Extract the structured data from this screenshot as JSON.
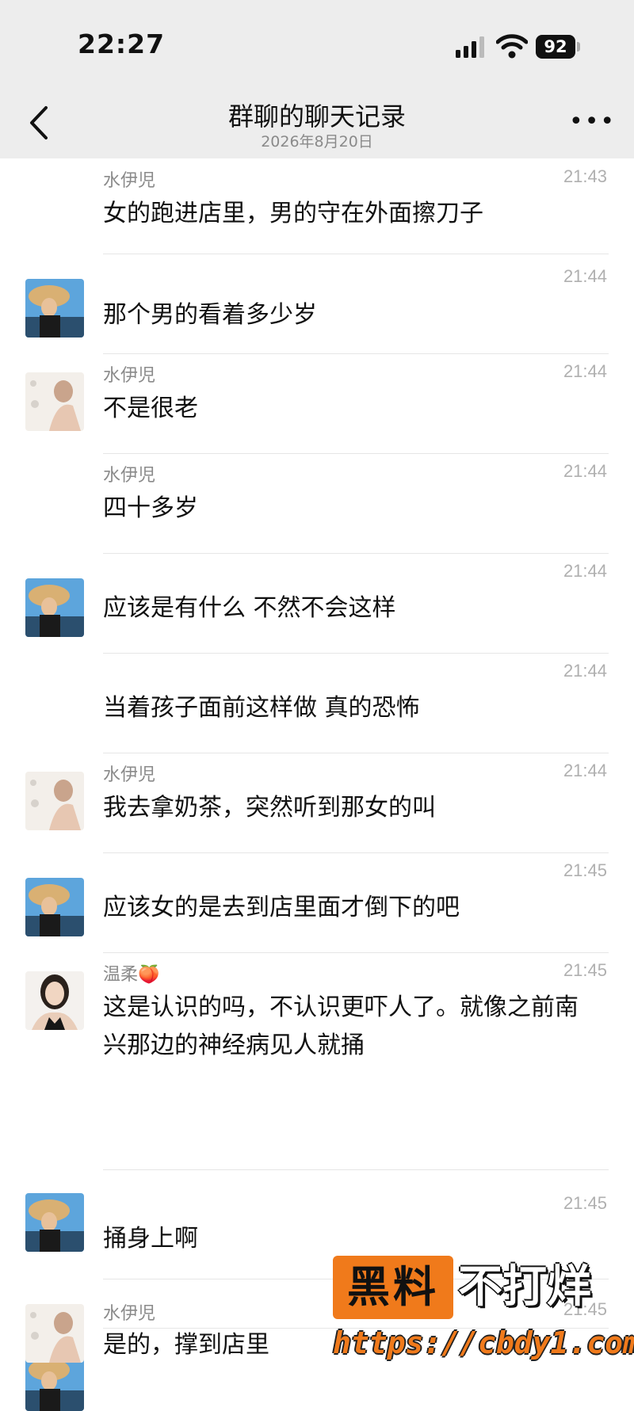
{
  "status_bar": {
    "time": "22:27",
    "battery": "92"
  },
  "nav": {
    "title": "群聊的聊天记录",
    "subtitle": "2026年8月20日",
    "more_label": "•••"
  },
  "messages": [
    {
      "sender": "水伊児",
      "time": "21:43",
      "text": "女的跑进店里，男的守在外面擦刀子",
      "avatar": "none"
    },
    {
      "sender": "",
      "time": "21:44",
      "text": "那个男的看着多少岁",
      "avatar": "sun-hat-woman"
    },
    {
      "sender": "水伊児",
      "time": "21:44",
      "text": "不是很老",
      "avatar": "pale-portrait-woman"
    },
    {
      "sender": "水伊児",
      "time": "21:44",
      "text": "四十多岁",
      "avatar": "none"
    },
    {
      "sender": "",
      "time": "21:44",
      "text": "应该是有什么 不然不会这样",
      "avatar": "sun-hat-woman"
    },
    {
      "sender": "",
      "time": "21:44",
      "text": "当着孩子面前这样做 真的恐怖",
      "avatar": "none"
    },
    {
      "sender": "水伊児",
      "time": "21:44",
      "text": "我去拿奶茶，突然听到那女的叫",
      "avatar": "pale-portrait-woman"
    },
    {
      "sender": "",
      "time": "21:45",
      "text": "应该女的是去到店里面才倒下的吧",
      "avatar": "sun-hat-woman"
    },
    {
      "sender": "温柔🍑",
      "time": "21:45",
      "text": "这是认识的吗，不认识更吓人了。就像之前南兴那边的神经病见人就捅",
      "avatar": "dark-hair-woman"
    },
    {
      "sender": "",
      "time": "21:45",
      "text": "捅身上啊",
      "avatar": "sun-hat-woman"
    },
    {
      "sender": "水伊児",
      "time": "21:45",
      "text": "是的，撑到店里",
      "avatar": "pale-portrait-woman"
    }
  ],
  "watermark": {
    "left": "黑料",
    "right": "不打烊",
    "url": "https://cbdy1.com"
  },
  "colors": {
    "nav_bg": "#ededed",
    "divider": "#e6e6e6",
    "meta_text": "#8a8a8a",
    "watermark_orange": "#f07a1b"
  }
}
